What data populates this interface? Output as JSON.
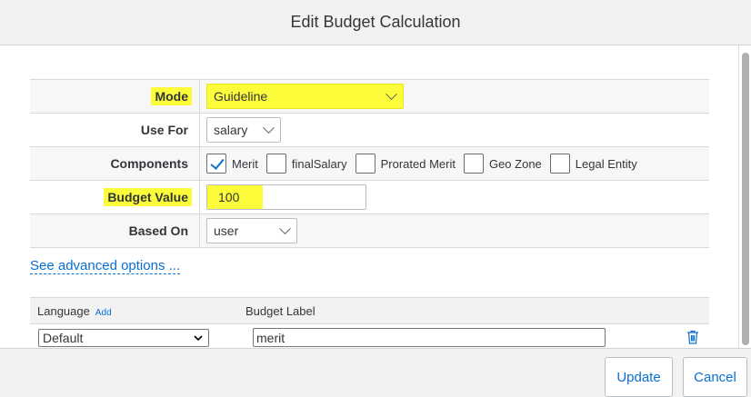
{
  "dialog": {
    "title": "Edit Budget Calculation"
  },
  "form": {
    "mode": {
      "label": "Mode",
      "value": "Guideline"
    },
    "use_for": {
      "label": "Use For",
      "value": "salary"
    },
    "components": {
      "label": "Components",
      "options": [
        {
          "label": "Merit",
          "checked": true
        },
        {
          "label": "finalSalary",
          "checked": false
        },
        {
          "label": "Prorated Merit",
          "checked": false
        },
        {
          "label": "Geo Zone",
          "checked": false
        },
        {
          "label": "Legal Entity",
          "checked": false
        }
      ]
    },
    "budget_value": {
      "label": "Budget Value",
      "value": "100"
    },
    "based_on": {
      "label": "Based On",
      "value": "user"
    }
  },
  "advanced_link": "See advanced options ...",
  "language_table": {
    "col_language": "Language",
    "add_label": "Add",
    "col_budget_label": "Budget Label",
    "rows": [
      {
        "language": "Default",
        "budget_label": "merit"
      }
    ]
  },
  "footer": {
    "update_label": "Update",
    "cancel_label": "Cancel"
  },
  "colors": {
    "highlight": "#fcfc3a",
    "accent": "#0a6ed1"
  }
}
